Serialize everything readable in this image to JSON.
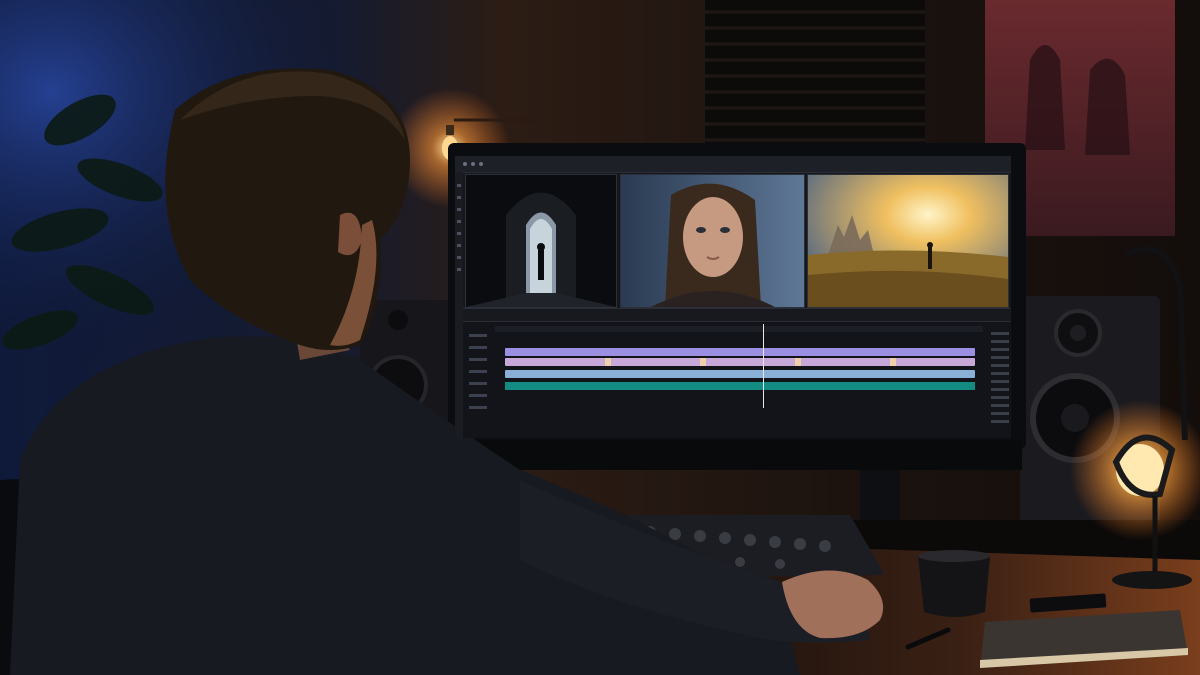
{
  "scene": {
    "description_colors": {
      "wall_left": "#141d3a",
      "wall_warm": "#3a2418",
      "lamp_glow": "#ffb347",
      "monitor_frame": "#0b0c0f",
      "timeline_purple": "#9a8fe0",
      "timeline_teal": "#138c84"
    },
    "icons": [
      "pendant-bulb",
      "desk-lamp",
      "speaker-left",
      "speaker-right",
      "coffee-mug",
      "pen",
      "notebook",
      "audio-mixer"
    ]
  },
  "editor": {
    "panels": [
      "preview-1",
      "preview-2",
      "preview-3"
    ],
    "tracks": [
      "video-track-1",
      "video-track-2",
      "audio-track-1",
      "audio-track-2"
    ]
  }
}
